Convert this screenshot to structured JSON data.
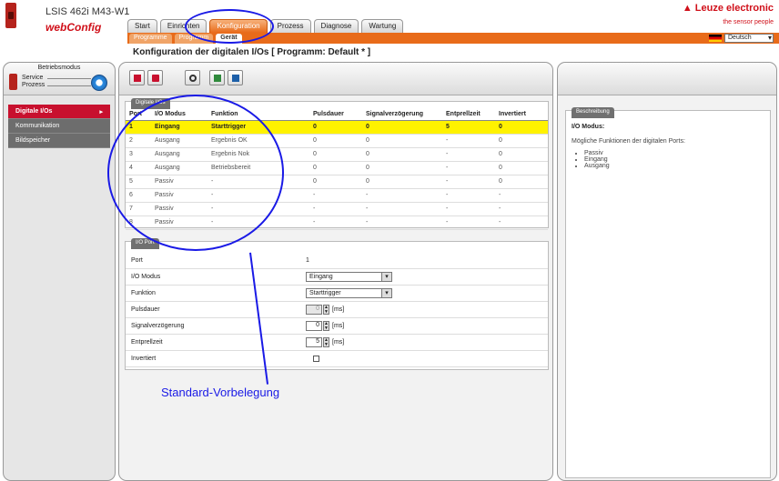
{
  "header": {
    "device_name": "LSIS 462i M43-W1",
    "app_name": "webConfig",
    "brand": "Leuze electronic",
    "tagline": "the sensor people",
    "language": "Deutsch"
  },
  "top_tabs": [
    {
      "label": "Start"
    },
    {
      "label": "Einrichten"
    },
    {
      "label": "Konfiguration"
    },
    {
      "label": "Prozess"
    },
    {
      "label": "Diagnose"
    },
    {
      "label": "Wartung"
    }
  ],
  "sub_tabs": [
    {
      "label": "Programme"
    },
    {
      "label": "Programm"
    },
    {
      "label": "Gerät"
    }
  ],
  "page_title": "Konfiguration der digitalen I/Os   [ Programm: Default * ]",
  "mode": {
    "heading": "Betriebsmodus",
    "service": "Service",
    "prozess": "Prozess"
  },
  "left_nav": [
    {
      "label": "Digitale I/Os"
    },
    {
      "label": "Kommunikation"
    },
    {
      "label": "Bildspeicher"
    }
  ],
  "io_table": {
    "section_title": "Digitale I/Os",
    "headers": [
      "Port",
      "I/O Modus",
      "Funktion",
      "Pulsdauer",
      "Signalverzögerung",
      "Entprellzeit",
      "Invertiert"
    ],
    "rows": [
      [
        "1",
        "Eingang",
        "Starttrigger",
        "0",
        "0",
        "5",
        "0"
      ],
      [
        "2",
        "Ausgang",
        "Ergebnis OK",
        "0",
        "0",
        "-",
        "0"
      ],
      [
        "3",
        "Ausgang",
        "Ergebnis Nok",
        "0",
        "0",
        "-",
        "0"
      ],
      [
        "4",
        "Ausgang",
        "Betriebsbereit",
        "0",
        "0",
        "-",
        "0"
      ],
      [
        "5",
        "Passiv",
        "-",
        "0",
        "0",
        "-",
        "0"
      ],
      [
        "6",
        "Passiv",
        "-",
        "-",
        "-",
        "-",
        "-"
      ],
      [
        "7",
        "Passiv",
        "-",
        "-",
        "-",
        "-",
        "-"
      ],
      [
        "8",
        "Passiv",
        "-",
        "-",
        "-",
        "-",
        "-"
      ]
    ]
  },
  "io_port": {
    "section_title": "I/O Port",
    "port_label": "Port",
    "port_value": "1",
    "mode_label": "I/O Modus",
    "mode_value": "Eingang",
    "function_label": "Funktion",
    "function_value": "Starttrigger",
    "pulse_label": "Pulsdauer",
    "pulse_value": "0",
    "delay_label": "Signalverzögerung",
    "delay_value": "0",
    "debounce_label": "Entprellzeit",
    "debounce_value": "5",
    "unit": "[ms]",
    "inverted_label": "Invertiert"
  },
  "annotation": "Standard-Vorbelegung",
  "description": {
    "section_title": "Beschreibung",
    "title": "I/O Modus:",
    "text": "Mögliche Funktionen der digitalen Ports:",
    "items": [
      "Passiv",
      "Eingang",
      "Ausgang"
    ]
  },
  "colors": {
    "accent": "#e86b1a",
    "brand_red": "#d0101a",
    "highlight": "#fff200",
    "annotation_blue": "#1a1ae6"
  }
}
